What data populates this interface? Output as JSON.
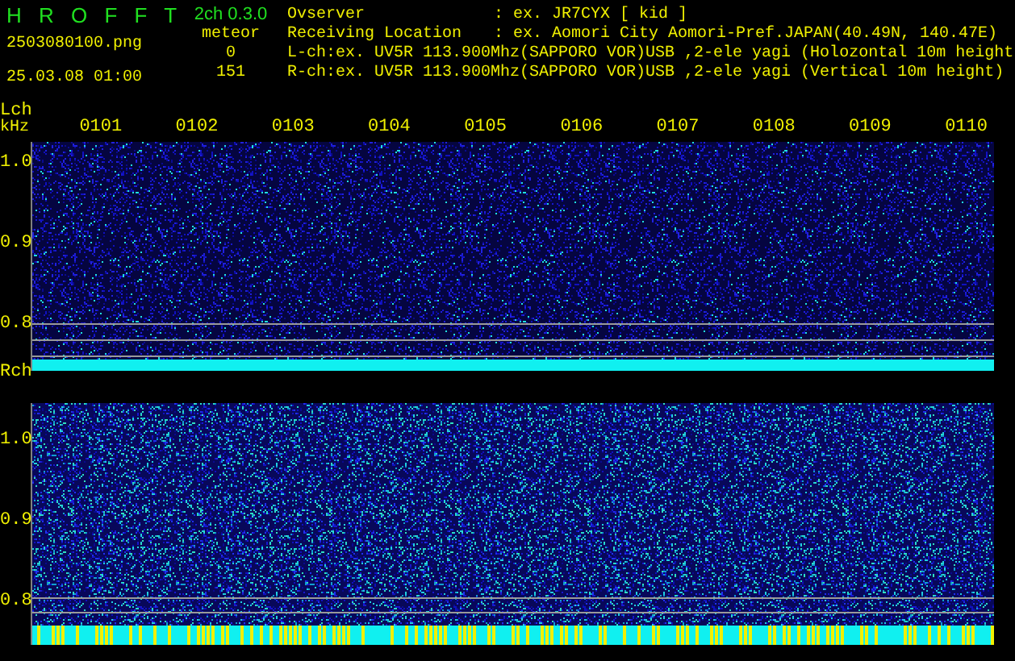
{
  "header": {
    "app_title": "H R O F F T",
    "version": "2ch 0.3.0",
    "filename": "2503080100.png",
    "datetime": "25.03.08 01:00",
    "meteor_label": "meteor",
    "meteor_counts": [
      "0",
      "151"
    ]
  },
  "info": [
    {
      "label": "Ovserver",
      "value": ": ex. JR7CYX [ kid ]"
    },
    {
      "label": "Receiving Location",
      "value": ": ex. Aomori City Aomori-Pref.JAPAN(40.49N, 140.47E)"
    },
    {
      "label": "L-ch:ex.",
      "value": "UV5R 113.900Mhz(SAPPORO VOR)USB ,2-ele yagi (Holozontal 10m height"
    },
    {
      "label": "R-ch:ex.",
      "value": "UV5R 113.900Mhz(SAPPORO VOR)USB ,2-ele yagi (Vertical 10m height)"
    }
  ],
  "panels": [
    {
      "kind": "quiet",
      "label": "Lch",
      "unit": "kHz",
      "time_labels": [
        "0101",
        "0102",
        "0103",
        "0104",
        "0105",
        "0106",
        "0107",
        "0108",
        "0109",
        "0110"
      ],
      "freq_labels": [
        "1.0",
        "0.9",
        "0.8"
      ]
    },
    {
      "kind": "busy",
      "label": "Rch",
      "freq_labels": [
        "1.0",
        "0.9",
        "0.8"
      ]
    }
  ]
}
